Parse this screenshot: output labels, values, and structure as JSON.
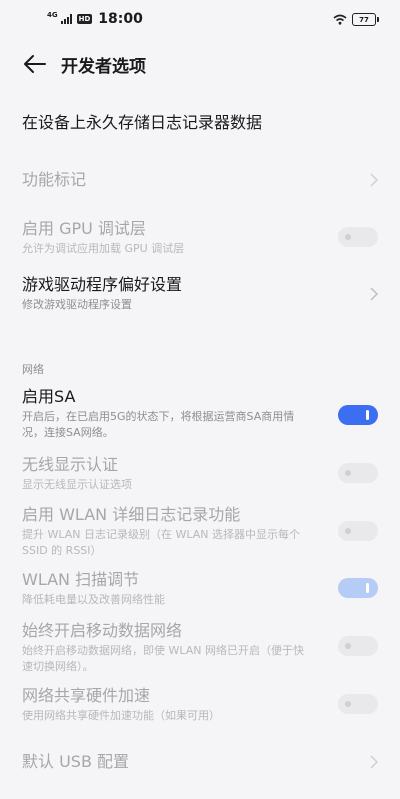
{
  "status_bar": {
    "network": "4G",
    "hd": "HD",
    "time": "18:00",
    "battery": "77"
  },
  "header": {
    "title": "开发者选项"
  },
  "items": [
    {
      "title": "在设备上永久存储日志记录器数据"
    },
    {
      "title": "功能标记"
    },
    {
      "title": "启用 GPU 调试层",
      "subtitle": "允许为调试应用加载 GPU 调试层"
    },
    {
      "title": "游戏驱动程序偏好设置",
      "subtitle": "修改游戏驱动程序设置"
    },
    {
      "title": "启用SA",
      "subtitle": "开启后，在已启用5G的状态下，将根据运营商SA商用情况，连接SA网络。"
    },
    {
      "title": "无线显示认证",
      "subtitle": "显示无线显示认证选项"
    },
    {
      "title": "启用 WLAN 详细日志记录功能",
      "subtitle": "提升 WLAN 日志记录级别（在 WLAN 选择器中显示每个 SSID 的 RSSI）"
    },
    {
      "title": "WLAN 扫描调节",
      "subtitle": "降低耗电量以及改善网络性能"
    },
    {
      "title": "始终开启移动数据网络",
      "subtitle": "始终开启移动数据网络，即使 WLAN 网络已开启（便于快速切换网络）。"
    },
    {
      "title": "网络共享硬件加速",
      "subtitle": "使用网络共享硬件加速功能（如果可用）"
    },
    {
      "title": "默认 USB 配置"
    }
  ],
  "section_network": "网络",
  "toggles": {
    "gpu_debug": false,
    "sa": true,
    "wireless_display": false,
    "wlan_verbose": false,
    "wlan_scan": true,
    "mobile_data": false,
    "tether_hw": false
  }
}
